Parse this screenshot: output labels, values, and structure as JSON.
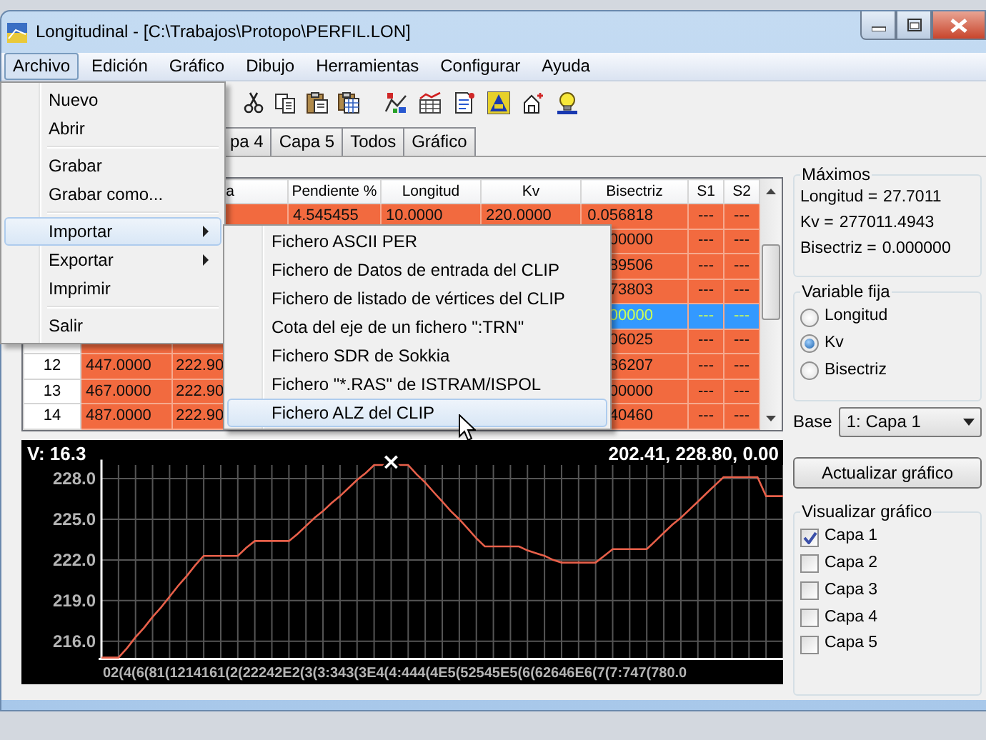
{
  "window": {
    "title": "Longitudinal - [C:\\Trabajos\\Protopo\\PERFIL.LON]"
  },
  "menu_bar": [
    {
      "label": "Archivo",
      "selected": true
    },
    {
      "label": "Edición",
      "selected": false
    },
    {
      "label": "Gráfico",
      "selected": false
    },
    {
      "label": "Dibujo",
      "selected": false
    },
    {
      "label": "Herramientas",
      "selected": false
    },
    {
      "label": "Configurar",
      "selected": false
    },
    {
      "label": "Ayuda",
      "selected": false
    }
  ],
  "toolbar": [
    {
      "kind": "scissors"
    },
    {
      "kind": "copy"
    },
    {
      "kind": "clipboard"
    },
    {
      "kind": "clipboard-table"
    },
    {
      "kind": "line-tool"
    },
    {
      "kind": "table-chart"
    },
    {
      "kind": "document"
    },
    {
      "kind": "tile"
    },
    {
      "kind": "house"
    },
    {
      "kind": "lightbulb"
    }
  ],
  "tabs": [
    {
      "label": "pa 4",
      "selected": false
    },
    {
      "label": "Capa 5",
      "selected": false
    },
    {
      "label": "Todos",
      "selected": false
    },
    {
      "label": "Gráfico",
      "selected": false
    }
  ],
  "table": {
    "columns": [
      {},
      {},
      {
        "label": "a"
      },
      {
        "label": "Pendiente %"
      },
      {
        "label": "Longitud"
      },
      {
        "label": "Kv"
      },
      {
        "label": "Bisectriz"
      },
      {
        "label": "S1"
      },
      {
        "label": "S2"
      }
    ],
    "rows": [
      {
        "selected": false,
        "cells": [
          null,
          null,
          null,
          "4.545455",
          "10.0000",
          "220.0000",
          "0.056818",
          "---",
          "---"
        ]
      },
      {
        "selected": false,
        "cells": [
          null,
          null,
          null,
          null,
          null,
          null,
          "00000",
          "---",
          "---"
        ]
      },
      {
        "selected": false,
        "cells": [
          null,
          null,
          null,
          null,
          null,
          null,
          "89506",
          "---",
          "---"
        ]
      },
      {
        "selected": false,
        "cells": [
          null,
          null,
          null,
          null,
          null,
          null,
          "73803",
          "---",
          "---"
        ]
      },
      {
        "selected": true,
        "cells": [
          null,
          null,
          null,
          null,
          null,
          null,
          "00000",
          "---",
          "---"
        ]
      },
      {
        "selected": false,
        "cells": [
          null,
          null,
          null,
          null,
          null,
          null,
          "06025",
          "---",
          "---"
        ]
      },
      {
        "selected": false,
        "cells": [
          "12",
          "447.0000",
          "222.90",
          null,
          null,
          null,
          "86207",
          "---",
          "---"
        ]
      },
      {
        "selected": false,
        "cells": [
          "13",
          "467.0000",
          "222.90",
          null,
          null,
          null,
          "00000",
          "---",
          "---"
        ]
      },
      {
        "selected": false,
        "cells": [
          "14",
          "487.0000",
          "222.90",
          null,
          null,
          null,
          "40460",
          "---",
          "---"
        ]
      }
    ]
  },
  "chart": {
    "top_left_text": "V: 16.3",
    "top_right_text": "202.41, 228.80, 0.00",
    "x_axis_text": "02(4(6(81(1214161(2(22242E2(3(3:343(3E4(4:444(4E5(52545E5(6(62646E6(7(7:747(780.0",
    "cursor_mark": "×",
    "chart_data": {
      "type": "line",
      "grid": true,
      "ylim": [
        214.7,
        229.5
      ],
      "yticks": [
        {
          "value": 228,
          "label": "228.0"
        },
        {
          "value": 225,
          "label": "225.0"
        },
        {
          "value": 222,
          "label": "222.0"
        },
        {
          "value": 219,
          "label": "219.0"
        },
        {
          "value": 216,
          "label": "216.0"
        }
      ],
      "categories": [
        null,
        null,
        null,
        null,
        null,
        null,
        null,
        null,
        null,
        null,
        null,
        null,
        null,
        null,
        null,
        null,
        null,
        null,
        null,
        null,
        null,
        null,
        null,
        null,
        null,
        null,
        null,
        null,
        null,
        null,
        null,
        null,
        null,
        null,
        null,
        null,
        null,
        null,
        null,
        null,
        null,
        null,
        null,
        null,
        null,
        null,
        null,
        null,
        null,
        null,
        null,
        null,
        null,
        null,
        null,
        null,
        null,
        null,
        null,
        null,
        null,
        null,
        null,
        null,
        null,
        null,
        null,
        null,
        null,
        null,
        null,
        null,
        null,
        null,
        null,
        null,
        null,
        null,
        null,
        null,
        null
      ],
      "series": [
        {
          "color": "#e8604a",
          "values": [
            214.8,
            214.8,
            214.8,
            215.5,
            216.3,
            217.0,
            217.8,
            218.5,
            219.3,
            220.1,
            220.8,
            221.6,
            222.3,
            222.3,
            222.3,
            222.3,
            222.3,
            222.9,
            223.4,
            223.4,
            223.4,
            223.4,
            223.4,
            223.9,
            224.5,
            225.1,
            225.6,
            226.2,
            226.7,
            227.3,
            227.9,
            228.4,
            229.0,
            229.0,
            229.0,
            229.0,
            229.0,
            228.3,
            227.7,
            227.0,
            226.3,
            225.6,
            225.0,
            224.3,
            223.6,
            223.0,
            223.0,
            223.0,
            223.0,
            223.0,
            222.7,
            222.5,
            222.3,
            222.0,
            221.8,
            221.8,
            221.8,
            221.8,
            221.8,
            222.3,
            222.8,
            222.8,
            222.8,
            222.8,
            222.8,
            223.4,
            224.0,
            224.6,
            225.1,
            225.7,
            226.3,
            226.9,
            227.5,
            228.1,
            228.1,
            228.1,
            228.1,
            228.1,
            226.7,
            226.7,
            226.7
          ]
        }
      ]
    }
  },
  "maximos": {
    "title": "Máximos",
    "rows": [
      {
        "label": "Longitud =",
        "value": "27.7011"
      },
      {
        "label": "Kv =",
        "value": "277011.4943"
      },
      {
        "label": "Bisectriz =",
        "value": "0.000000"
      }
    ]
  },
  "variable_fija": {
    "title": "Variable fija",
    "options": [
      {
        "label": "Longitud",
        "selected": false
      },
      {
        "label": "Kv",
        "selected": true
      },
      {
        "label": "Bisectriz",
        "selected": false
      }
    ]
  },
  "base": {
    "label": "Base",
    "value": "1: Capa 1"
  },
  "update_button": "Actualizar gráfico",
  "visualizar": {
    "title": "Visualizar gráfico",
    "layers": [
      {
        "label": "Capa 1",
        "checked": true
      },
      {
        "label": "Capa 2",
        "checked": false
      },
      {
        "label": "Capa 3",
        "checked": false
      },
      {
        "label": "Capa 4",
        "checked": false
      },
      {
        "label": "Capa 5",
        "checked": false
      }
    ]
  },
  "file_menu": {
    "groups": [
      [
        {
          "label": "Nuevo",
          "selected": false,
          "submenu": false
        },
        {
          "label": "Abrir",
          "selected": false,
          "submenu": false
        }
      ],
      [
        {
          "label": "Grabar",
          "selected": false,
          "submenu": false
        },
        {
          "label": "Grabar como...",
          "selected": false,
          "submenu": false
        }
      ],
      [
        {
          "label": "Importar",
          "selected": true,
          "submenu": true
        },
        {
          "label": "Exportar",
          "selected": false,
          "submenu": true
        },
        {
          "label": "Imprimir",
          "selected": false,
          "submenu": false
        }
      ],
      [
        {
          "label": "Salir",
          "selected": false,
          "submenu": false
        }
      ]
    ]
  },
  "import_submenu": [
    {
      "label": "Fichero ASCII PER",
      "selected": false
    },
    {
      "label": "Fichero de Datos de entrada del CLIP",
      "selected": false
    },
    {
      "label": "Fichero de listado de vértices del CLIP",
      "selected": false
    },
    {
      "label": "Cota del eje de un fichero \":TRN\"",
      "selected": false
    },
    {
      "label": "Fichero SDR de Sokkia",
      "selected": false
    },
    {
      "label": "Fichero \"*.RAS\" de ISTRAM/ISPOL",
      "selected": false
    },
    {
      "label": "Fichero ALZ del CLIP",
      "selected": true
    }
  ]
}
